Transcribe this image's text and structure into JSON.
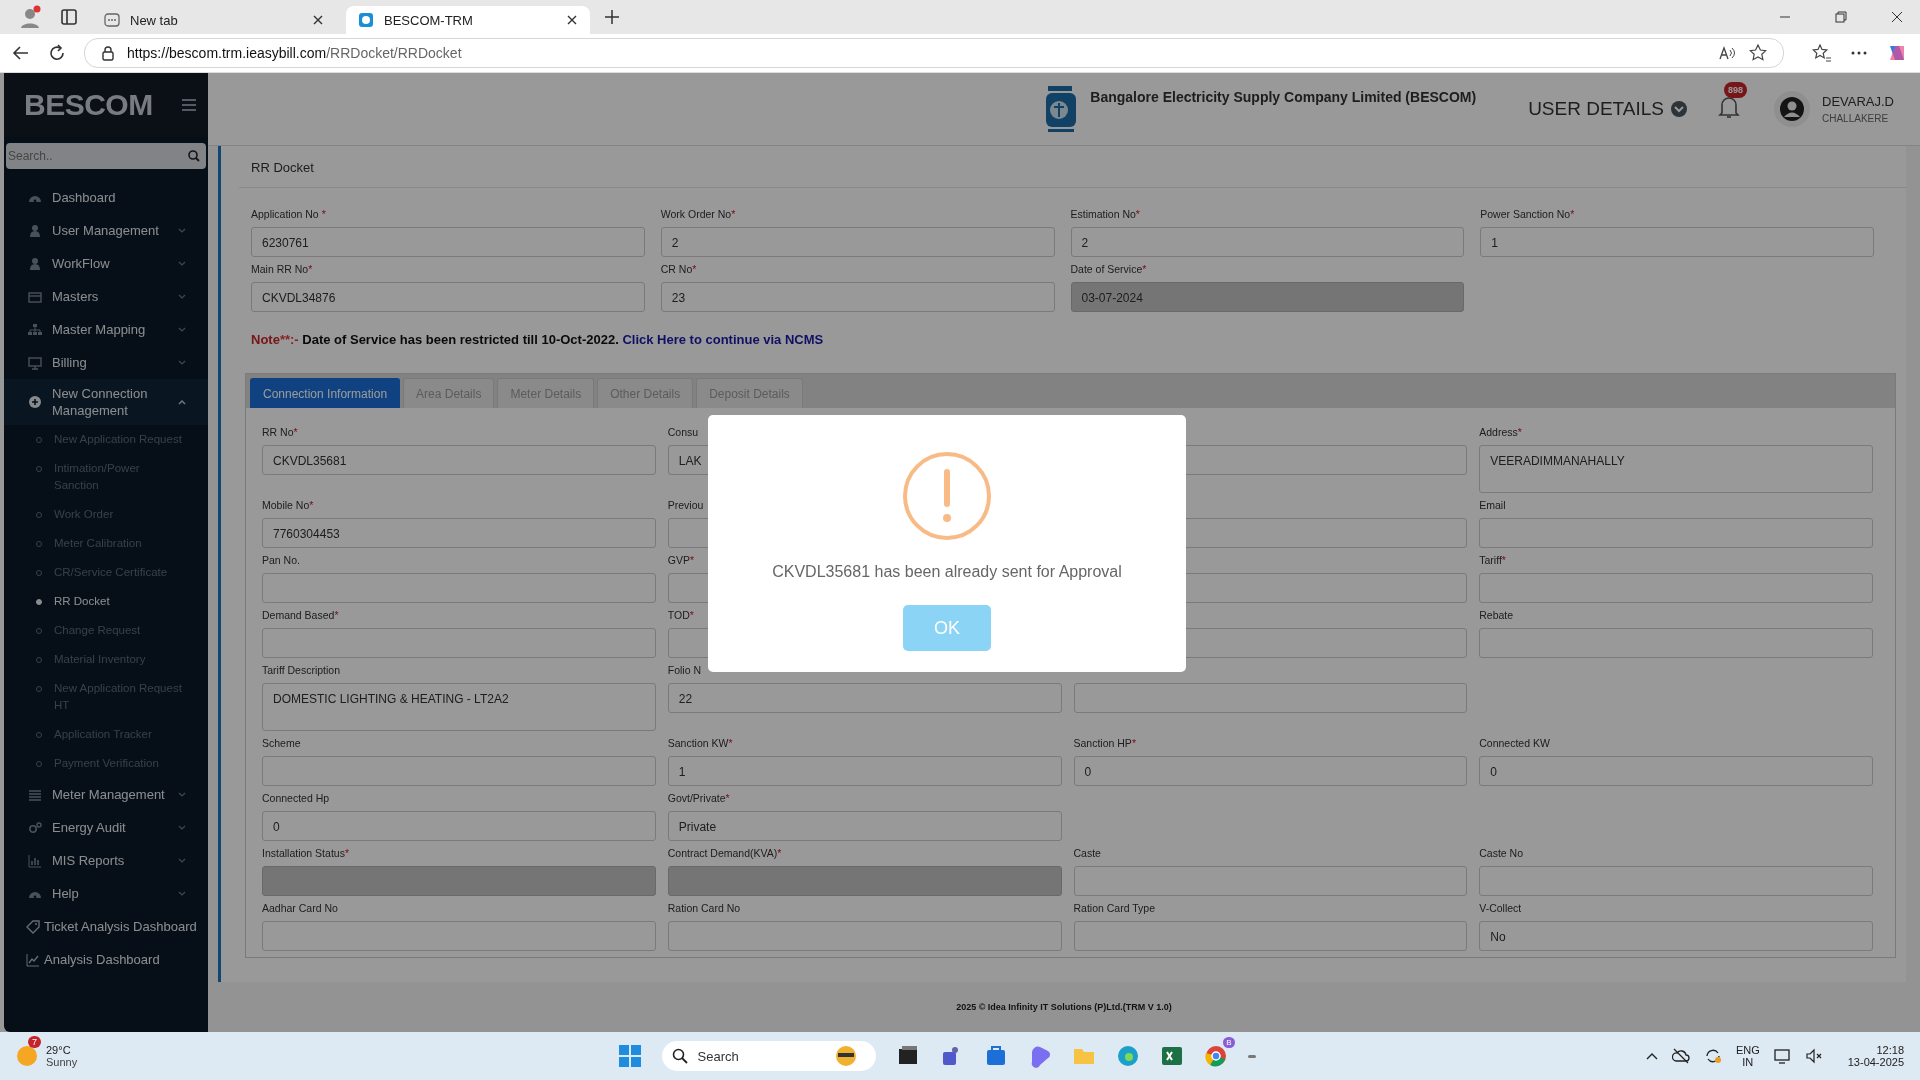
{
  "browser": {
    "tabs": [
      {
        "label": "New tab",
        "selected": false
      },
      {
        "label": "BESCOM-TRM",
        "selected": true
      }
    ],
    "url_host": "https://bescom.trm.ieasybill.com",
    "url_path": "/RRDocket/RRDocket"
  },
  "sidebar": {
    "brand": "BESCOM",
    "search_placeholder": "Search..",
    "items": [
      {
        "label": "Dashboard",
        "kind": "link"
      },
      {
        "label": "User Management",
        "kind": "group",
        "expanded": false
      },
      {
        "label": "WorkFlow",
        "kind": "group",
        "expanded": false
      },
      {
        "label": "Masters",
        "kind": "group",
        "expanded": false
      },
      {
        "label": "Master Mapping",
        "kind": "group",
        "expanded": false
      },
      {
        "label": "Billing",
        "kind": "group",
        "expanded": false
      },
      {
        "label": "New Connection Management",
        "kind": "group",
        "expanded": true,
        "children": [
          {
            "label": "New Application Request",
            "selected": false
          },
          {
            "label": "Intimation/Power Sanction",
            "selected": false
          },
          {
            "label": "Work Order",
            "selected": false
          },
          {
            "label": "Meter Calibration",
            "selected": false
          },
          {
            "label": "CR/Service Certificate",
            "selected": false
          },
          {
            "label": "RR Docket",
            "selected": true
          },
          {
            "label": "Change Request",
            "selected": false
          },
          {
            "label": "Material Inventory",
            "selected": false
          },
          {
            "label": "New Application Request HT",
            "selected": false
          },
          {
            "label": "Application Tracker",
            "selected": false
          },
          {
            "label": "Payment Verification",
            "selected": false
          }
        ]
      },
      {
        "label": "Meter Management",
        "kind": "group",
        "expanded": false
      },
      {
        "label": "Energy Audit",
        "kind": "group",
        "expanded": false
      },
      {
        "label": "MIS Reports",
        "kind": "group",
        "expanded": false
      },
      {
        "label": "Help",
        "kind": "group",
        "expanded": false
      },
      {
        "label": "Ticket Analysis Dashboard",
        "kind": "link"
      },
      {
        "label": "Analysis Dashboard",
        "kind": "link"
      }
    ]
  },
  "header": {
    "company": "Bangalore Electricity Supply Company Limited (BESCOM)",
    "user_details": "USER DETAILS",
    "notifications": "898",
    "user_name": "DEVARAJ.D",
    "user_location": "CHALLAKERE"
  },
  "page_title": "RR Docket",
  "top_fields": [
    {
      "label": "Application No ",
      "mark": "*",
      "value": "6230761",
      "disabled": false
    },
    {
      "label": "Work Order No",
      "mark": "*",
      "value": "2",
      "disabled": false
    },
    {
      "label": "Estimation No",
      "mark": "*",
      "value": "2",
      "disabled": false
    },
    {
      "label": "Power Sanction No",
      "mark": "*",
      "value": "1",
      "disabled": false
    },
    {
      "label": "Main RR No",
      "mark": "*",
      "value": "CKVDL34876",
      "disabled": false
    },
    {
      "label": "CR No",
      "mark": "*",
      "value": "23",
      "disabled": false
    },
    {
      "label": "Date of Service",
      "mark": "*",
      "value": "03-07-2024",
      "disabled": true
    }
  ],
  "note": {
    "prefix": "Note",
    "mark": "**:-",
    "text": " Date of Service has been restricted till 10-Oct-2022. ",
    "link": "Click Here to continue via NCMS"
  },
  "tabs": [
    {
      "label": "Connection Information",
      "selected": true
    },
    {
      "label": "Area Details",
      "selected": false
    },
    {
      "label": "Meter Details",
      "selected": false
    },
    {
      "label": "Other Details",
      "selected": false
    },
    {
      "label": "Deposit Details",
      "selected": false
    }
  ],
  "fields": [
    {
      "label": "RR No",
      "mark": "*",
      "value": "CKVDL35681",
      "disabled": false,
      "kind": "input"
    },
    {
      "label": "Consu",
      "value": "LAK",
      "disabled": false,
      "kind": "input"
    },
    {
      "disabled": false,
      "kind": "input"
    },
    {
      "label": "Address",
      "mark": "*",
      "value": "VEERADIMMANAHALLY",
      "disabled": false,
      "kind": "textarea"
    },
    {
      "label": "Mobile No",
      "mark": "*",
      "value": "7760304453",
      "disabled": false,
      "kind": "input"
    },
    {
      "label": "Previou",
      "disabled": false,
      "kind": "input"
    },
    {
      "disabled": false,
      "kind": "input"
    },
    {
      "label": "Email",
      "disabled": false,
      "kind": "input"
    },
    {
      "label": "Pan No.",
      "disabled": false,
      "kind": "input"
    },
    {
      "label": "GVP",
      "mark": "*",
      "disabled": false,
      "kind": "input"
    },
    {
      "disabled": false,
      "kind": "input"
    },
    {
      "label": "Tariff",
      "mark": "*",
      "disabled": false,
      "kind": "input"
    },
    {
      "label": "Demand Based",
      "mark": "*",
      "disabled": false,
      "kind": "input"
    },
    {
      "label": "TOD",
      "mark": "*",
      "disabled": false,
      "kind": "input"
    },
    {
      "disabled": false,
      "kind": "input"
    },
    {
      "label": "Rebate",
      "disabled": false,
      "kind": "input"
    },
    {
      "label": "Tariff Description",
      "value": "DOMESTIC LIGHTING & HEATING - LT2A2",
      "disabled": false,
      "kind": "textarea"
    },
    {
      "label": "Folio N",
      "value": "22",
      "disabled": false,
      "kind": "input"
    },
    {
      "disabled": false,
      "kind": "input"
    },
    {
      "kind": "empty"
    },
    {
      "label": "Scheme",
      "disabled": false,
      "kind": "input"
    },
    {
      "label": "Sanction KW",
      "mark": "*",
      "value": "1",
      "disabled": false,
      "kind": "input"
    },
    {
      "label": "Sanction HP",
      "mark": "*",
      "value": "0",
      "disabled": false,
      "kind": "input"
    },
    {
      "label": "Connected KW",
      "value": "0",
      "disabled": false,
      "kind": "input"
    },
    {
      "label": "Connected Hp",
      "value": "0",
      "disabled": false,
      "kind": "input"
    },
    {
      "label": "Govt/Private",
      "mark": "*",
      "value": "Private",
      "disabled": false,
      "kind": "input"
    },
    {
      "kind": "empty"
    },
    {
      "kind": "empty"
    },
    {
      "label": "Installation Status",
      "mark": "*",
      "disabled": true,
      "kind": "input"
    },
    {
      "label": "Contract Demand(KVA)",
      "mark": "*",
      "disabled": true,
      "kind": "input"
    },
    {
      "label": "Caste",
      "disabled": false,
      "kind": "input"
    },
    {
      "label": "Caste No",
      "disabled": false,
      "kind": "input"
    },
    {
      "label": "Aadhar Card No",
      "disabled": false,
      "kind": "input"
    },
    {
      "label": "Ration Card No",
      "disabled": false,
      "kind": "input"
    },
    {
      "label": "Ration Card Type",
      "disabled": false,
      "kind": "input"
    },
    {
      "label": "V-Collect",
      "value": "No",
      "disabled": false,
      "kind": "input"
    }
  ],
  "footer": "2025 © Idea Infinity IT Solutions (P)Ltd.(TRM V 1.0)",
  "modal": {
    "message": "CKVDL35681 has been already sent for Approval",
    "button": "OK"
  },
  "taskbar": {
    "weather_badge": "7",
    "temperature": "29°C",
    "condition": "Sunny",
    "search": "Search",
    "browser_badge": "B",
    "language": "ENG",
    "region": "IN",
    "time": "12:18",
    "date": "13-04-2025"
  }
}
